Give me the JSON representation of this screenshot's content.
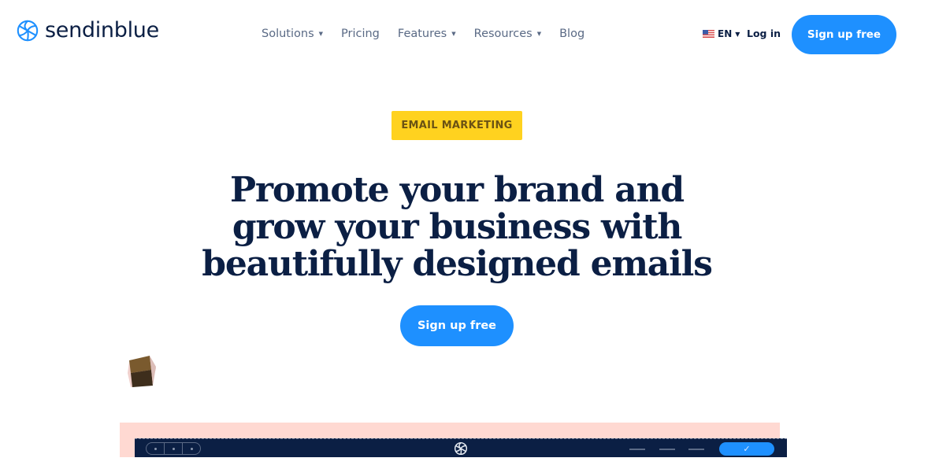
{
  "brand": {
    "name": "sendinblue",
    "logo_icon": "sendinblue-swirl-icon",
    "accent_color": "#1e90ff",
    "navy_color": "#0b1f44"
  },
  "nav": {
    "items": [
      {
        "label": "Solutions",
        "has_dropdown": true
      },
      {
        "label": "Pricing",
        "has_dropdown": false
      },
      {
        "label": "Features",
        "has_dropdown": true
      },
      {
        "label": "Resources",
        "has_dropdown": true
      },
      {
        "label": "Blog",
        "has_dropdown": false
      }
    ],
    "caret_glyph": "▾"
  },
  "header": {
    "language": {
      "code": "EN",
      "flag_icon": "us-flag-icon",
      "caret": "▾"
    },
    "login_label": "Log in",
    "signup_label": "Sign up free"
  },
  "hero": {
    "tag": "EMAIL MARKETING",
    "tag_color": "#ffd21f",
    "headline_lines": [
      "Promote your brand and",
      "grow your business with",
      "beautifully designed emails"
    ],
    "cta_label": "Sign up free"
  },
  "preview": {
    "background_color": "#ffd9d2",
    "bar_color": "#0b1f44",
    "confirm_icon": "✓"
  }
}
